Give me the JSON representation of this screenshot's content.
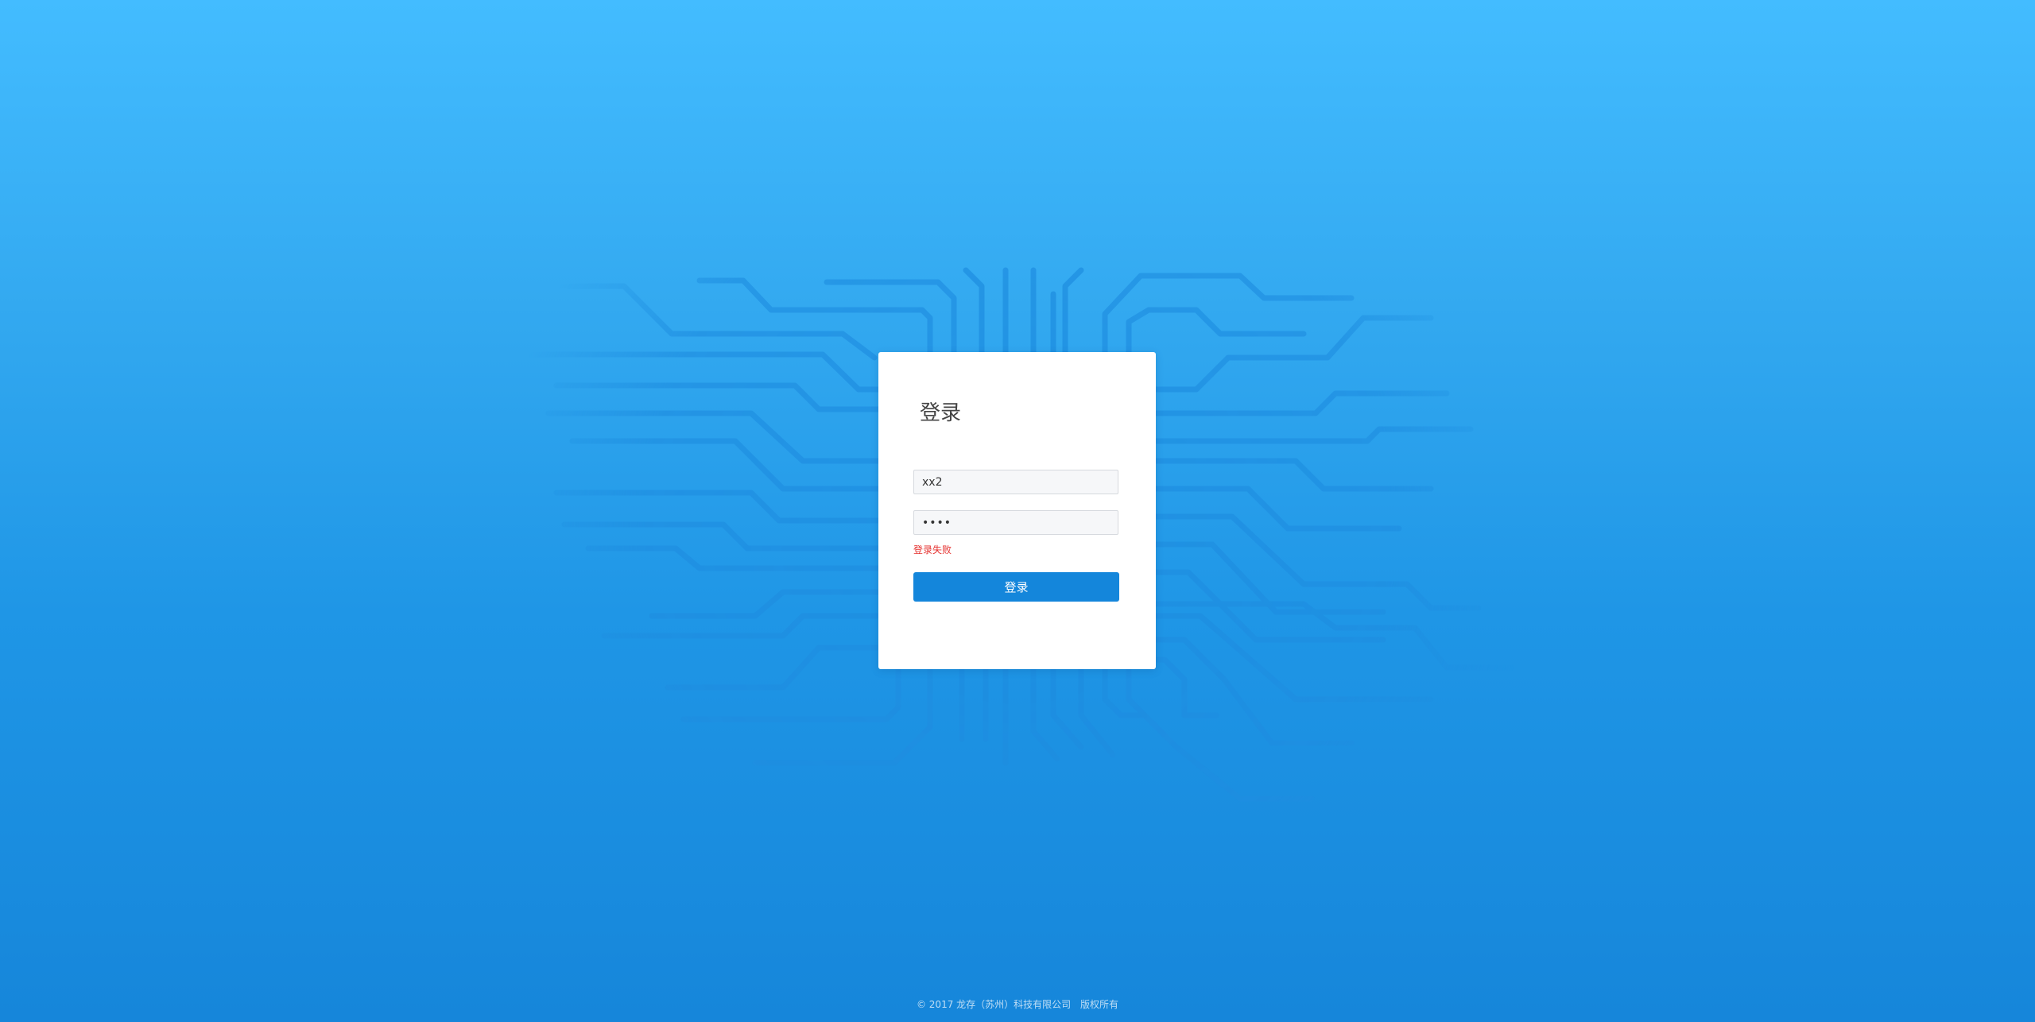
{
  "login": {
    "title": "登录",
    "username_value": "xx2",
    "password_value": "••••",
    "error_message": "登录失败",
    "submit_label": "登录"
  },
  "footer": {
    "copyright": "© 2017 龙存（苏州）科技有限公司",
    "rights": "版权所有"
  },
  "colors": {
    "background_top": "#43bcff",
    "background_bottom": "#1686da",
    "button": "#1486db",
    "error": "#e5302e"
  }
}
